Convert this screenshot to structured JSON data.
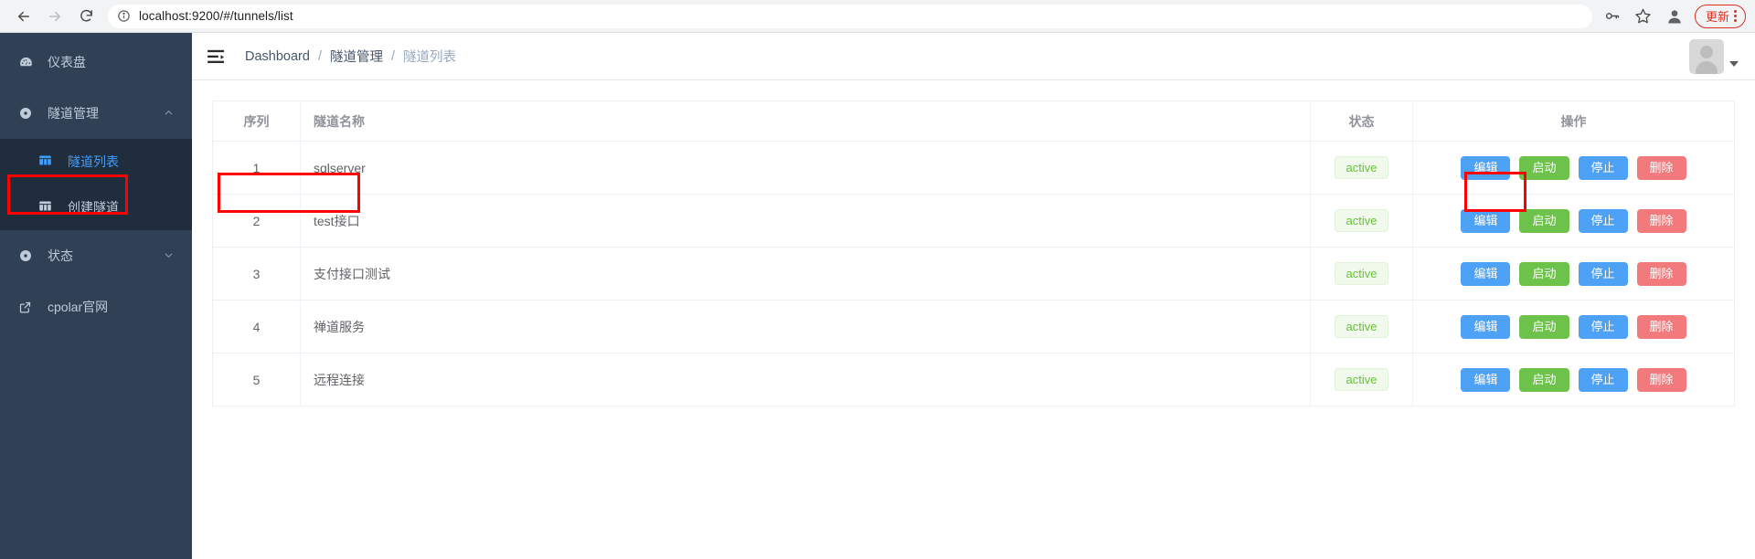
{
  "browser": {
    "back_icon": "arrow-left-icon",
    "forward_icon": "arrow-right-icon",
    "reload_icon": "reload-icon",
    "info_icon": "site-info-icon",
    "url_scheme": "localhost:9200",
    "url_path": "/#/tunnels/list",
    "url_full": "localhost:9200/#/tunnels/list",
    "key_icon": "key-icon",
    "star_icon": "star-icon",
    "profile_icon": "profile-avatar-icon",
    "update_label": "更新",
    "menu_icon": "three-dots-vertical-icon",
    "accent_red": "#d93025"
  },
  "sidebar": {
    "bg": "#304156",
    "active_color": "#409eff",
    "items": [
      {
        "label": "仪表盘",
        "icon": "dashboard-icon",
        "type": "item"
      },
      {
        "label": "隧道管理",
        "icon": "tunnel-icon",
        "type": "group",
        "caret": "chevron-up-icon"
      },
      {
        "label": "隧道列表",
        "icon": "list-grid-icon",
        "type": "sub",
        "active": true
      },
      {
        "label": "创建隧道",
        "icon": "grid-icon",
        "type": "sub",
        "active": false
      },
      {
        "label": "状态",
        "icon": "status-icon",
        "type": "group",
        "caret": "chevron-down-icon"
      },
      {
        "label": "cpolar官网",
        "icon": "external-link-icon",
        "type": "item"
      }
    ]
  },
  "navbar": {
    "hamburger_icon": "collapse-menu-icon",
    "breadcrumb": [
      {
        "label": "Dashboard",
        "current": false
      },
      {
        "label": "隧道管理",
        "current": false
      },
      {
        "label": "隧道列表",
        "current": true
      }
    ],
    "separator": "/",
    "avatar_icon": "user-avatar",
    "caret_icon": "caret-down-icon"
  },
  "table": {
    "columns": [
      "序列",
      "隧道名称",
      "状态",
      "操作"
    ],
    "rows": [
      {
        "seq": "1",
        "name": "sqlserver",
        "status": "active",
        "ops": [
          "编辑",
          "启动",
          "停止",
          "删除"
        ]
      },
      {
        "seq": "2",
        "name": "test接口",
        "status": "active",
        "ops": [
          "编辑",
          "启动",
          "停止",
          "删除"
        ]
      },
      {
        "seq": "3",
        "name": "支付接口测试",
        "status": "active",
        "ops": [
          "编辑",
          "启动",
          "停止",
          "删除"
        ]
      },
      {
        "seq": "4",
        "name": "禅道服务",
        "status": "active",
        "ops": [
          "编辑",
          "启动",
          "停止",
          "删除"
        ]
      },
      {
        "seq": "5",
        "name": "远程连接",
        "status": "active",
        "ops": [
          "编辑",
          "启动",
          "停止",
          "删除"
        ]
      }
    ]
  },
  "annotations": {
    "highlight_color": "#ff0000",
    "boxes": [
      "sidebar-tunnel-list-item",
      "table-row-2-seq-and-name",
      "table-row-2-edit-button"
    ]
  }
}
